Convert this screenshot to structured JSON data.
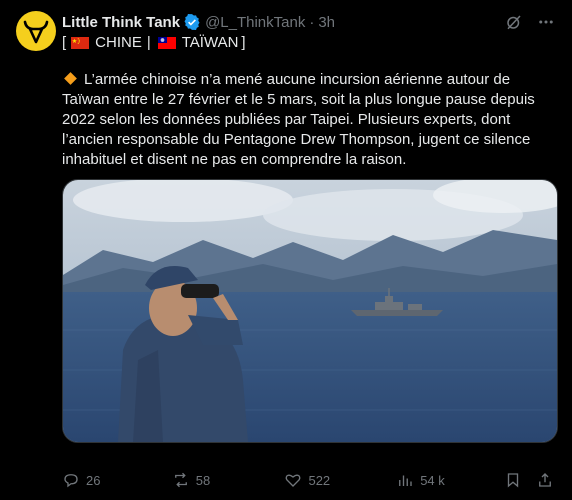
{
  "post": {
    "author_name": "Little Think Tank",
    "handle": "@L_ThinkTank",
    "separator": "·",
    "time": "3h",
    "tag_open": "[",
    "tag_china": "CHINE",
    "tag_sep": "|",
    "tag_taiwan": "TAÏWAN",
    "tag_close": "]",
    "body": "L’armée chinoise n’a mené aucune incursion aérienne autour de Taïwan entre le 27 février et le 5 mars, soit la plus longue pause depuis 2022 selon les données publiées par Taipei. Plusieurs experts, dont l’ancien responsable du Pentagone Drew Thompson, jugent ce silence inhabituel et disent ne pas en comprendre la raison."
  },
  "actions": {
    "replies": "26",
    "reposts": "58",
    "likes": "522",
    "views": "54 k"
  },
  "colors": {
    "background": "#000000",
    "text": "#e7e9ea",
    "muted": "#71767b",
    "verified": "#1d9bf0",
    "avatar": "#f5cf1d"
  },
  "icons": [
    "verified-badge-icon",
    "grok-icon",
    "more-icon",
    "reply-icon",
    "repost-icon",
    "like-icon",
    "views-icon",
    "bookmark-icon",
    "share-icon"
  ]
}
